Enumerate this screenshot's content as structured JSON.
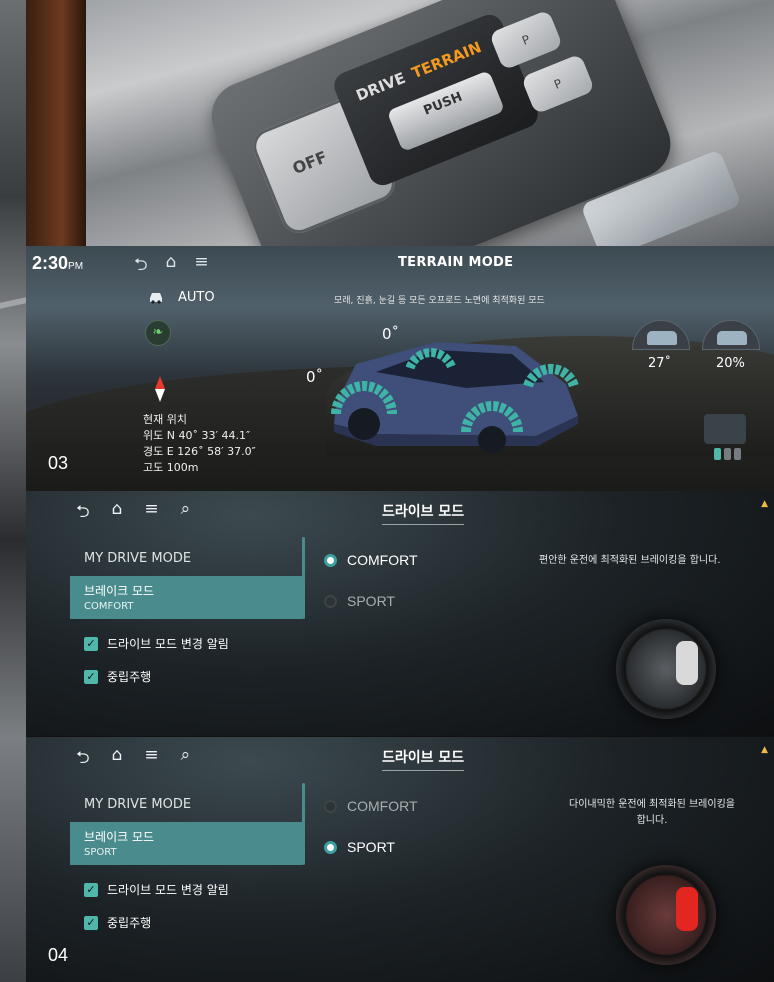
{
  "photo": {
    "off_button": "OFF",
    "drive_label": "DRIVE",
    "terrain_label": "TERRAIN",
    "push_label": "PUSH"
  },
  "terrain_screen": {
    "time": "2:30",
    "time_suffix": "PM",
    "title": "TERRAIN MODE",
    "description": "모래, 진흙, 눈길 등 모든 오프로드 노면에 최적화된 모드",
    "mode": "AUTO",
    "location_heading": "현재 위치",
    "latitude": "위도  N   40˚ 33′ 44.1″",
    "longitude": "경도  E  126˚ 58′ 37.0″",
    "altitude": "고도  100m",
    "front_angle": "0˚",
    "side_angle": "0˚",
    "pitch_value": "27˚",
    "roll_value": "20%",
    "section_label": "03"
  },
  "drive_mode_1": {
    "title": "드라이브 모드",
    "heading": "MY DRIVE MODE",
    "brake_title": "브레이크 모드",
    "brake_value": "COMFORT",
    "check1": "드라이브 모드 변경 알림",
    "check2": "중립주행",
    "option1": "COMFORT",
    "option2": "SPORT",
    "description": "편안한 운전에 최적화된 브레이킹을 합니다."
  },
  "drive_mode_2": {
    "title": "드라이브 모드",
    "heading": "MY DRIVE MODE",
    "brake_title": "브레이크 모드",
    "brake_value": "SPORT",
    "check1": "드라이브 모드 변경 알림",
    "check2": "중립주행",
    "option1": "COMFORT",
    "option2": "SPORT",
    "description_line1": "다이내믹한 운전에 최적화된 브레이킹을",
    "description_line2": "합니다.",
    "section_label": "04"
  },
  "colors": {
    "accent": "#4fb8aa",
    "panel_teal": "#4a8c8e",
    "caliper_comfort": "#d9d9d9",
    "caliper_sport": "#e3261f",
    "terrain_orange": "#f39a1f"
  },
  "icons": [
    "back-icon",
    "home-icon",
    "menu-icon",
    "search-icon",
    "car-icon",
    "leaf-icon",
    "compass-icon"
  ]
}
